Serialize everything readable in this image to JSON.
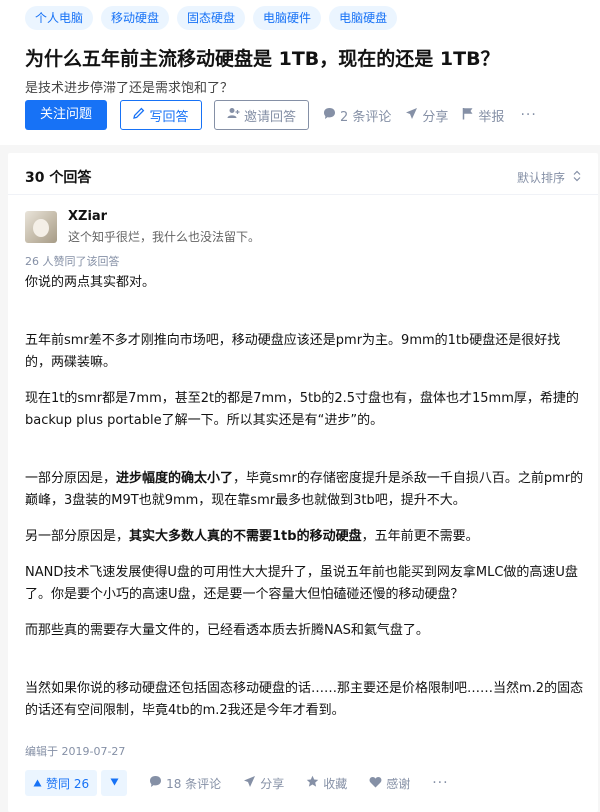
{
  "tags": [
    "个人电脑",
    "移动硬盘",
    "固态硬盘",
    "电脑硬件",
    "电脑硬盘"
  ],
  "question": {
    "title": "为什么五年前主流移动硬盘是 1TB，现在的还是 1TB？",
    "description": "是技术进步停滞了还是需求饱和了？"
  },
  "question_actions": {
    "follow": "关注问题",
    "write": "写回答",
    "invite": "邀请回答",
    "comments": "2 条评论",
    "share": "分享",
    "report": "举报",
    "more": "···"
  },
  "answers": {
    "count": "30 个回答",
    "sort": "默认排序"
  },
  "answer": {
    "author_name": "XZiar",
    "author_bio": "这个知乎很烂，我什么也没法留下。",
    "vote_summary": "26 人赞同了该回答",
    "p1": "你说的两点其实都对。",
    "p2": "五年前smr差不多才刚推向市场吧，移动硬盘应该还是pmr为主。9mm的1tb硬盘还是很好找的，两碟装嘛。",
    "p3": "现在1t的smr都是7mm，甚至2t的都是7mm，5tb的2.5寸盘也有，盘体也才15mm厚，希捷的backup plus portable了解一下。所以其实还是有“进步”的。",
    "p4_a": "一部分原因是，",
    "p4_b": "进步幅度的确太小了",
    "p4_c": "，毕竟smr的存储密度提升是杀敌一千自损八百。之前pmr的巅峰，3盘装的M9T也就9mm，现在靠smr最多也就做到3tb吧，提升不大。",
    "p5_a": "另一部分原因是，",
    "p5_b": "其实大多数人真的不需要1tb的移动硬盘",
    "p5_c": "，五年前更不需要。",
    "p6": "NAND技术飞速发展使得U盘的可用性大大提升了，虽说五年前也能买到网友拿MLC做的高速U盘了。你是要个小巧的高速U盘，还是要一个容量大但怕磕碰还慢的移动硬盘？",
    "p7": "而那些真的需要存大量文件的，已经看透本质去折腾NAS和氦气盘了。",
    "p8": "当然如果你说的移动硬盘还包括固态移动硬盘的话……那主要还是价格限制吧……当然m.2的固态的话还有空间限制，毕竟4tb的m.2我还是今年才看到。",
    "edited": "编辑于 2019-07-27"
  },
  "answer_actions": {
    "vote_up": "赞同 26",
    "comments": "18 条评论",
    "share": "分享",
    "favorite": "收藏",
    "thanks": "感谢",
    "more": "···"
  },
  "colors": {
    "accent": "#1772f6",
    "accent_bg": "#ebf5ff",
    "muted": "#8590a6"
  }
}
